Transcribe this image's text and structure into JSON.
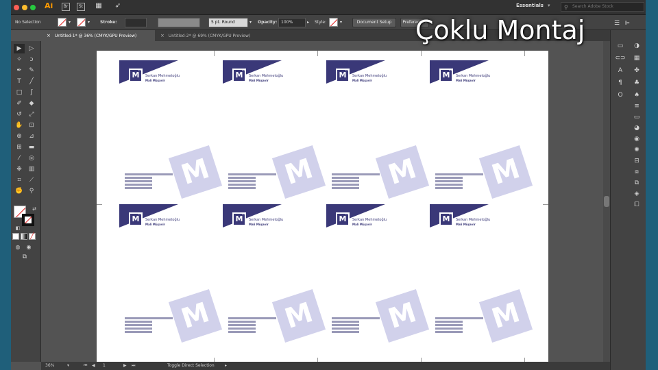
{
  "app": {
    "logo": "Ai",
    "bridge": "Br",
    "stock": "St",
    "workspace": "Essentials",
    "search_placeholder": "Search Adobe Stock"
  },
  "control_bar": {
    "selection": "No Selection",
    "stroke_label": "Stroke:",
    "brush": "5 pt. Round",
    "opacity_label": "Opacity:",
    "opacity_value": "100%",
    "style_label": "Style:",
    "document_setup": "Document Setup",
    "preferences": "Preferences"
  },
  "tabs": [
    {
      "label": "Untitled-1* @ 36% (CMYK/GPU Preview)"
    },
    {
      "label": "Untitled-2* @ 69% (CMYK/GPU Preview)"
    }
  ],
  "card": {
    "logo_letter": "M",
    "logo_sup": "m",
    "name": "Serkan Mehmetoğlu",
    "title": "Mali Müşavir"
  },
  "overlay": {
    "title": "Çoklu Montaj"
  },
  "status": {
    "zoom": "36%",
    "page": "1",
    "tool_hint": "Toggle Direct Selection"
  },
  "icons": [
    "selection-icon",
    "direct-selection-icon",
    "magic-wand-icon",
    "lasso-icon",
    "pen-icon",
    "curvature-icon",
    "type-icon",
    "line-icon",
    "rectangle-icon",
    "paintbrush-icon",
    "shaper-icon",
    "eraser-icon",
    "rotate-icon",
    "scale-icon",
    "warp-icon",
    "free-transform-icon",
    "shape-builder-icon",
    "perspective-icon",
    "mesh-icon",
    "gradient-icon",
    "eyedropper-icon",
    "blend-icon",
    "symbol-sprayer-icon",
    "graph-icon",
    "artboard-icon",
    "slice-icon",
    "hand-icon",
    "zoom-icon"
  ]
}
